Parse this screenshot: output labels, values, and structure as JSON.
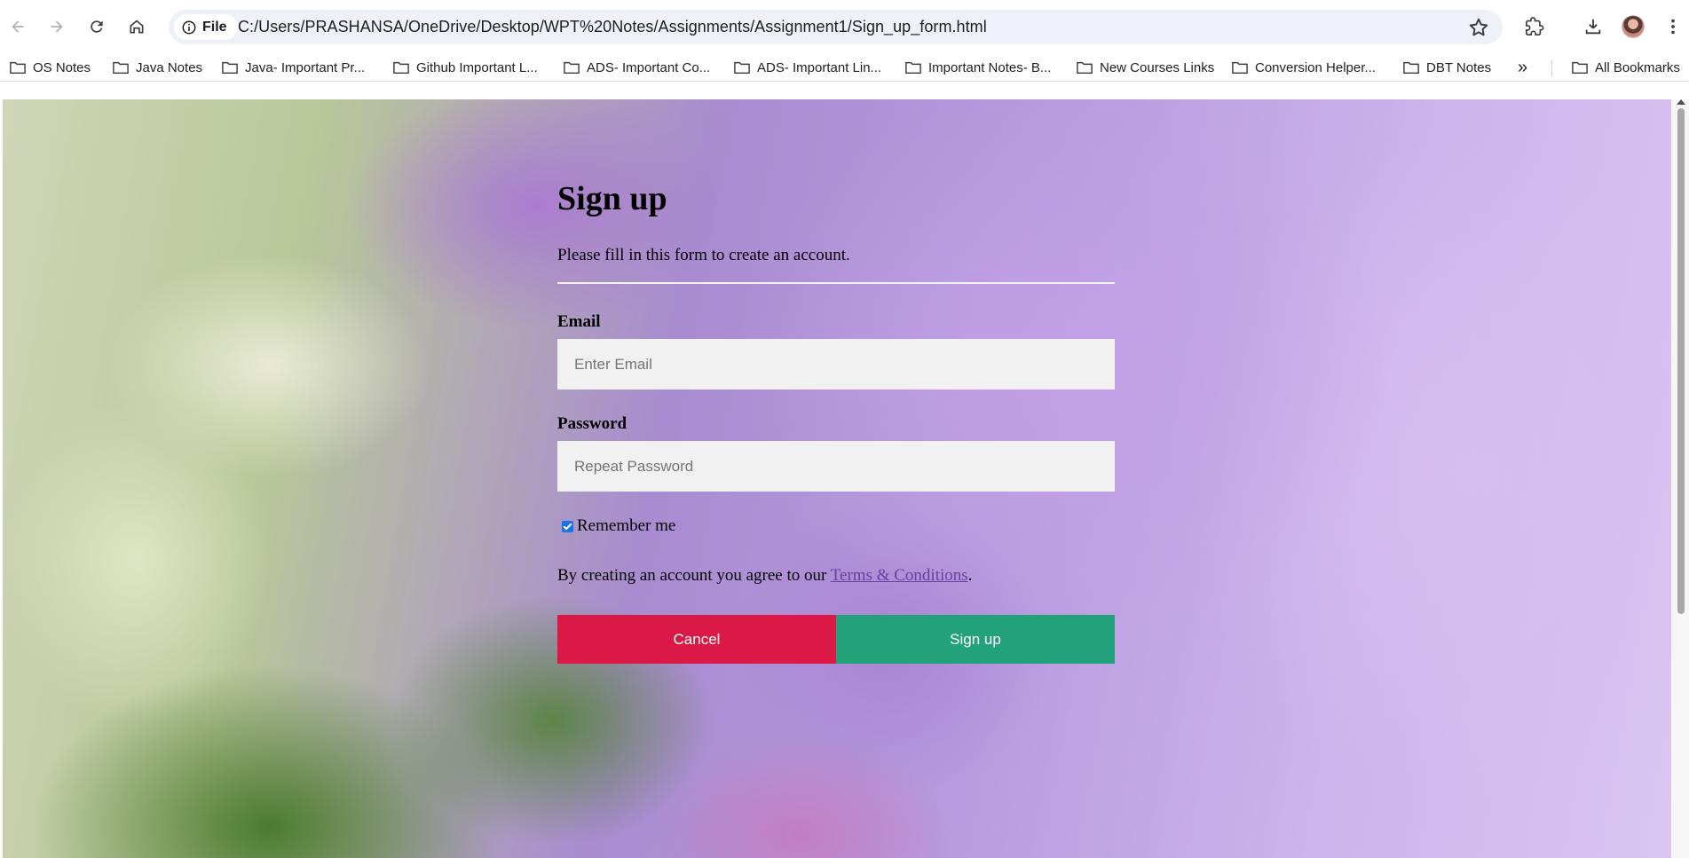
{
  "browser": {
    "file_chip_label": "File",
    "url": "C:/Users/PRASHANSA/OneDrive/Desktop/WPT%20Notes/Assignments/Assignment1/Sign_up_form.html",
    "bookmarks": [
      "OS Notes",
      "Java Notes",
      "Java- Important Pr...",
      "Github Important L...",
      "ADS- Important Co...",
      "ADS- Important Lin...",
      "Important Notes- B...",
      "New Courses Links",
      "Conversion Helper...",
      "DBT Notes"
    ],
    "overflow_label": "»",
    "all_bookmarks_label": "All Bookmarks"
  },
  "form": {
    "title": "Sign up",
    "subtitle": "Please fill in this form to create an account.",
    "email_label": "Email",
    "email_placeholder": "Enter Email",
    "password_label": "Password",
    "password_placeholder": "Repeat Password",
    "remember_label": "Remember me",
    "remember_checked": true,
    "terms_prefix": "By creating an account you agree to our ",
    "terms_link": "Terms & Conditions",
    "terms_suffix": ".",
    "cancel_label": "Cancel",
    "signup_label": "Sign up"
  },
  "colors": {
    "cancel": "#db1946",
    "signup": "#22a17a",
    "field_bg": "#f1f1f1"
  }
}
